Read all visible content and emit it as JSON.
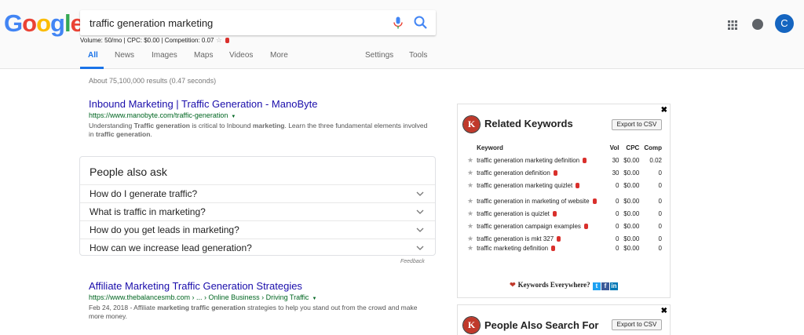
{
  "logo": {
    "letters": [
      "G",
      "o",
      "o",
      "g",
      "l",
      "e"
    ],
    "colors": [
      "#4285f4",
      "#ea4335",
      "#fbbc05",
      "#4285f4",
      "#34a853",
      "#ea4335"
    ]
  },
  "search": {
    "query": "traffic generation marketing"
  },
  "kwe_line": {
    "text": "Volume: 50/mo | CPC: $0.00 | Competition: 0.07",
    "star": "☆"
  },
  "tabs": {
    "all": "All",
    "news": "News",
    "images": "Images",
    "maps": "Maps",
    "videos": "Videos",
    "more": "More",
    "settings": "Settings",
    "tools": "Tools"
  },
  "user": {
    "initial": "C",
    "avatar_color": "#1565c0"
  },
  "stats": "About 75,100,000 results (0.47 seconds)",
  "result1": {
    "title": "Inbound Marketing | Traffic Generation - ManoByte",
    "url": "https://www.manobyte.com/traffic-generation",
    "snippet_a": "Understanding ",
    "snippet_b": "Traffic generation",
    "snippet_c": " is critical to Inbound ",
    "snippet_d": "marketing",
    "snippet_e": ". Learn the three fundamental elements involved in ",
    "snippet_f": "traffic generation",
    "snippet_g": "."
  },
  "paa": {
    "title": "People also ask",
    "questions": [
      "How do I generate traffic?",
      "What is traffic in marketing?",
      "How do you get leads in marketing?",
      "How can we increase lead generation?"
    ],
    "feedback": "Feedback"
  },
  "result2": {
    "title": "Affiliate Marketing Traffic Generation Strategies",
    "url": "https://www.thebalancesmb.com › ... › Online Business › Driving Traffic",
    "snippet_a": "Feb 24, 2018 - Affiliate ",
    "snippet_b": "marketing traffic generation",
    "snippet_c": " strategies to help you stand out from the crowd and make more money."
  },
  "related": {
    "close": "✖",
    "logo_letter": "K",
    "title": "Related Keywords",
    "export": "Export to CSV",
    "headers": {
      "keyword": "Keyword",
      "vol": "Vol",
      "cpc": "CPC",
      "comp": "Comp"
    },
    "rows": [
      {
        "keyword": "traffic generation marketing definition",
        "vol": "30",
        "cpc": "$0.00",
        "comp": "0.02"
      },
      {
        "keyword": "traffic generation definition",
        "vol": "30",
        "cpc": "$0.00",
        "comp": "0"
      },
      {
        "keyword": "traffic generation marketing quizlet",
        "vol": "0",
        "cpc": "$0.00",
        "comp": "0"
      },
      {
        "keyword": "traffic generation in marketing of website",
        "vol": "0",
        "cpc": "$0.00",
        "comp": "0"
      },
      {
        "keyword": "traffic generation is quizlet",
        "vol": "0",
        "cpc": "$0.00",
        "comp": "0"
      },
      {
        "keyword": "traffic generation campaign examples",
        "vol": "0",
        "cpc": "$0.00",
        "comp": "0"
      },
      {
        "keyword": "traffic generation is mkt 327",
        "vol": "0",
        "cpc": "$0.00",
        "comp": "0"
      },
      {
        "keyword": "traffic marketing definition",
        "vol": "0",
        "cpc": "$0.00",
        "comp": "0"
      }
    ],
    "footer": "Keywords Everywhere?"
  },
  "people_also_search": {
    "close": "✖",
    "logo_letter": "K",
    "title": "People Also Search For",
    "export": "Export to CSV"
  }
}
